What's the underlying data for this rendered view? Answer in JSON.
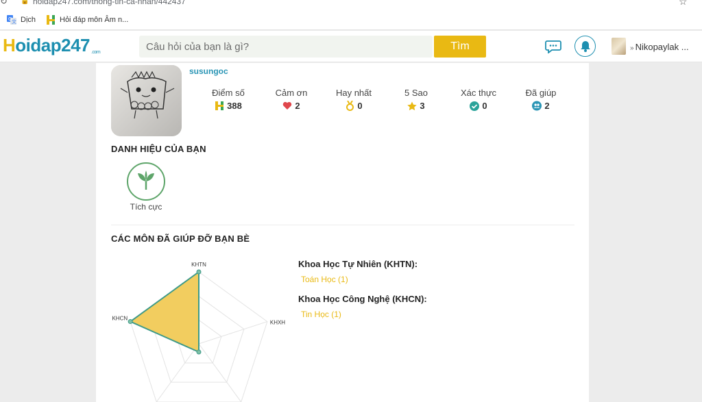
{
  "browser": {
    "url": "hoidap247.com/thong-tin-ca-nhan/442437",
    "bookmarks": [
      {
        "label": "Dịch",
        "icon": "google-translate-icon"
      },
      {
        "label": "Hỏi đáp môn Âm n...",
        "icon": "hoidap-h-icon"
      }
    ]
  },
  "header": {
    "logo_text": "oidap247",
    "logo_h": "H",
    "logo_sub": ".com",
    "search_placeholder": "Câu hỏi của bạn là gì?",
    "search_button": "Tìm",
    "user_name": "Nikopaylak ..."
  },
  "profile": {
    "username": "susungoc",
    "stats": [
      {
        "label": "Điểm số",
        "value": "388",
        "icon": "hoidap-h-icon",
        "color": "#e9b913"
      },
      {
        "label": "Cảm ơn",
        "value": "2",
        "icon": "heart-icon",
        "color": "#e0474c"
      },
      {
        "label": "Hay nhất",
        "value": "0",
        "icon": "medal-icon",
        "color": "#e9b913"
      },
      {
        "label": "5 Sao",
        "value": "3",
        "icon": "star-icon",
        "color": "#e9b913"
      },
      {
        "label": "Xác thực",
        "value": "0",
        "icon": "verified-check-icon",
        "color": "#2aa39a"
      },
      {
        "label": "Đã giúp",
        "value": "2",
        "icon": "users-icon",
        "color": "#2a95b5"
      }
    ]
  },
  "titles": {
    "section_title": "DANH HIỆU CỦA BẠN",
    "badge_label": "Tích cực"
  },
  "subjects": {
    "section_title": "CÁC MÔN ĐÃ GIÚP ĐỠ BẠN BÈ",
    "radar": {
      "axes": [
        "KHTN",
        "KHXH",
        "",
        "",
        "KHCN"
      ],
      "fill_color": "#f2cd5f",
      "stroke_color": "#3d9a89"
    },
    "groups": [
      {
        "title": "Khoa Học Tự Nhiên (KHTN):",
        "item": "Toán Học (1)"
      },
      {
        "title": "Khoa Học Công Nghệ (KHCN):",
        "item": "Tin Học (1)"
      }
    ]
  }
}
